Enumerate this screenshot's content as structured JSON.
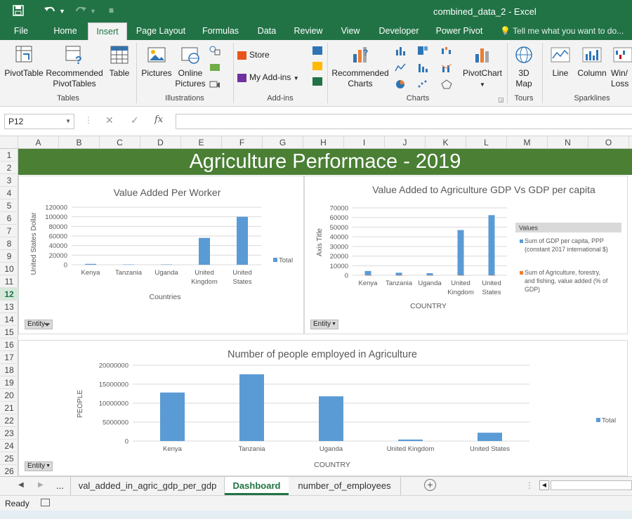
{
  "window": {
    "title": "combined_data_2 - Excel"
  },
  "tabs": [
    {
      "label": "File"
    },
    {
      "label": "Home"
    },
    {
      "label": "Insert"
    },
    {
      "label": "Page Layout"
    },
    {
      "label": "Formulas"
    },
    {
      "label": "Data"
    },
    {
      "label": "Review"
    },
    {
      "label": "View"
    },
    {
      "label": "Developer"
    },
    {
      "label": "Power Pivot"
    }
  ],
  "tell_me": "Tell me what you want to do...",
  "ribbon": {
    "pivottable": "PivotTable",
    "recommended_pivot_1": "Recommended",
    "recommended_pivot_2": "PivotTables",
    "table": "Table",
    "pictures": "Pictures",
    "online_pictures_1": "Online",
    "online_pictures_2": "Pictures",
    "store": "Store",
    "my_addins": "My Add-ins",
    "recommended_charts_1": "Recommended",
    "recommended_charts_2": "Charts",
    "pivotchart": "PivotChart",
    "map_1": "3D",
    "map_2": "Map",
    "line": "Line",
    "column": "Column",
    "winloss_1": "Win/",
    "winloss_2": "Loss",
    "groups": {
      "tables": "Tables",
      "illustrations": "Illustrations",
      "addins": "Add-ins",
      "charts": "Charts",
      "tours": "Tours",
      "sparklines": "Sparklines"
    }
  },
  "formula_bar": {
    "name_box": "P12",
    "formula": ""
  },
  "columns": [
    "A",
    "B",
    "C",
    "D",
    "E",
    "F",
    "G",
    "H",
    "I",
    "J",
    "K",
    "L",
    "M",
    "N",
    "O"
  ],
  "rows": [
    "1",
    "2",
    "3",
    "4",
    "5",
    "6",
    "7",
    "8",
    "9",
    "10",
    "11",
    "12",
    "13",
    "14",
    "15",
    "16",
    "17",
    "18",
    "19",
    "20",
    "21",
    "22",
    "23",
    "24",
    "25",
    "26"
  ],
  "selected_row": "12",
  "banner_title": "Agriculture Performace - 2019",
  "chart_data": [
    {
      "type": "bar",
      "title": "Value Added Per Worker",
      "xlabel": "Countries",
      "ylabel": "United States Dollar",
      "categories": [
        "Kenya",
        "Tanzania",
        "Uganda",
        "United Kingdom",
        "United States"
      ],
      "series": [
        {
          "name": "Total",
          "values": [
            1800,
            600,
            700,
            56000,
            100000
          ]
        }
      ],
      "ylim": [
        0,
        120000
      ],
      "yticks": [
        "0",
        "20000",
        "40000",
        "60000",
        "80000",
        "100000",
        "120000"
      ],
      "legend": "right",
      "filter_label": "Entity",
      "color": "#5b9bd5"
    },
    {
      "type": "bar",
      "title": "Value Added to Agriculture GDP Vs GDP per capita",
      "xlabel": "COUNTRY",
      "ylabel": "Axis Title",
      "categories": [
        "Kenya",
        "Tanzania",
        "Uganda",
        "United Kingdom",
        "United States"
      ],
      "series": [
        {
          "name": "Sum of GDP per capita, PPP (constant 2017 international $)",
          "values": [
            4500,
            2700,
            2200,
            47000,
            62500
          ]
        },
        {
          "name": "Sum of Agriculture, forestry, and fishing, value added (% of GDP)",
          "values": [
            34,
            28,
            23,
            0.6,
            0.9
          ]
        }
      ],
      "ylim": [
        0,
        70000
      ],
      "yticks": [
        "0",
        "10000",
        "20000",
        "30000",
        "40000",
        "50000",
        "60000",
        "70000"
      ],
      "legend_title": "Values",
      "legend": "right",
      "filter_label": "Entity",
      "colors": [
        "#5b9bd5",
        "#ed7d31"
      ]
    },
    {
      "type": "bar",
      "title": "Number of people employed in Agriculture",
      "xlabel": "COUNTRY",
      "ylabel": "PEOPLE",
      "categories": [
        "Kenya",
        "Tanzania",
        "Uganda",
        "United Kingdom",
        "United States"
      ],
      "series": [
        {
          "name": "Total",
          "values": [
            12800000,
            17600000,
            11800000,
            400000,
            2200000
          ]
        }
      ],
      "ylim": [
        0,
        20000000
      ],
      "yticks": [
        "0",
        "5000000",
        "10000000",
        "15000000",
        "20000000"
      ],
      "legend": "right",
      "filter_label": "Entity",
      "color": "#5b9bd5"
    }
  ],
  "sheet_tabs": {
    "ellipsis": "...",
    "tabs": [
      {
        "label": "val_added_in_agric_gdp_per_gdp"
      },
      {
        "label": "Dashboard"
      },
      {
        "label": "number_of_employees"
      }
    ],
    "active": "Dashboard"
  },
  "status": {
    "ready": "Ready"
  },
  "colors": {
    "excel_green": "#217346",
    "banner_green": "#4a7f34",
    "bar_blue": "#5b9bd5",
    "orange": "#ed7d31"
  }
}
